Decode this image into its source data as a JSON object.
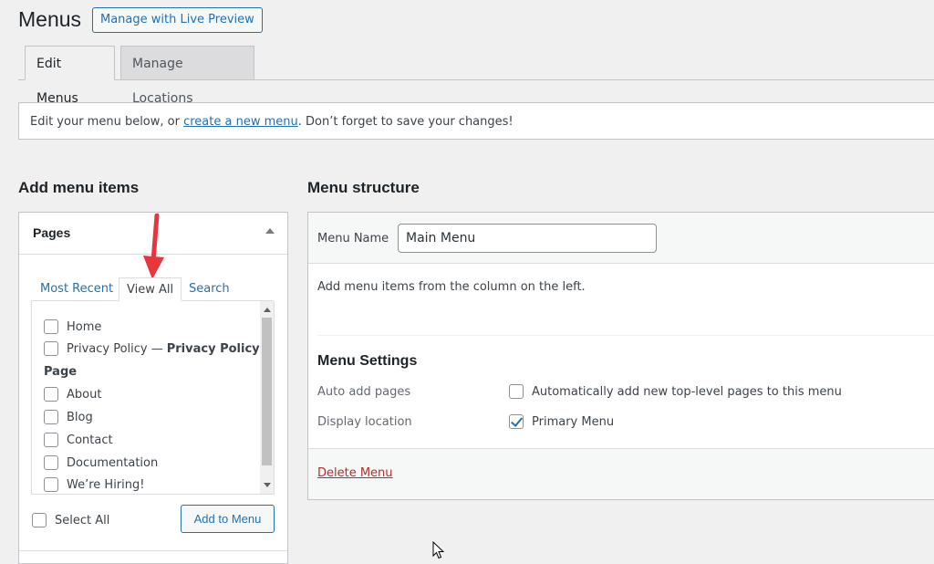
{
  "header": {
    "title": "Menus",
    "live_preview_label": "Manage with Live Preview"
  },
  "tabs": [
    {
      "label": "Edit Menus",
      "active": true
    },
    {
      "label": "Manage Locations",
      "active": false
    }
  ],
  "notice": {
    "prefix": "Edit your menu below, or ",
    "link": "create a new menu",
    "suffix": ". Don’t forget to save your changes!"
  },
  "left": {
    "section_title": "Add menu items",
    "panel_title": "Pages",
    "inner_tabs": [
      {
        "label": "Most Recent",
        "active": false
      },
      {
        "label": "View All",
        "active": true
      },
      {
        "label": "Search",
        "active": false
      }
    ],
    "items_top": [
      {
        "label": "Home",
        "checked": false
      },
      {
        "label": "Privacy Policy — ",
        "bold": "Privacy Policy",
        "checked": false
      }
    ],
    "group_label": "Page",
    "items_group": [
      {
        "label": "About",
        "checked": false
      },
      {
        "label": "Blog",
        "checked": false
      },
      {
        "label": "Contact",
        "checked": false
      },
      {
        "label": "Documentation",
        "checked": false
      },
      {
        "label": "We’re Hiring!",
        "checked": false
      }
    ],
    "select_all_label": "Select All",
    "add_button_label": "Add to Menu"
  },
  "right": {
    "section_title": "Menu structure",
    "menu_name_label": "Menu Name",
    "menu_name_value": "Main Menu",
    "instructions": "Add menu items from the column on the left.",
    "settings_title": "Menu Settings",
    "auto_add_label": "Auto add pages",
    "auto_add_option": "Automatically add new top-level pages to this menu",
    "auto_add_checked": false,
    "display_location_label": "Display location",
    "display_location_option": "Primary Menu",
    "display_location_checked": true,
    "delete_label": "Delete Menu"
  },
  "colors": {
    "link": "#2271b1",
    "delete": "#b32d2e",
    "annotation_arrow": "#e8363f"
  }
}
